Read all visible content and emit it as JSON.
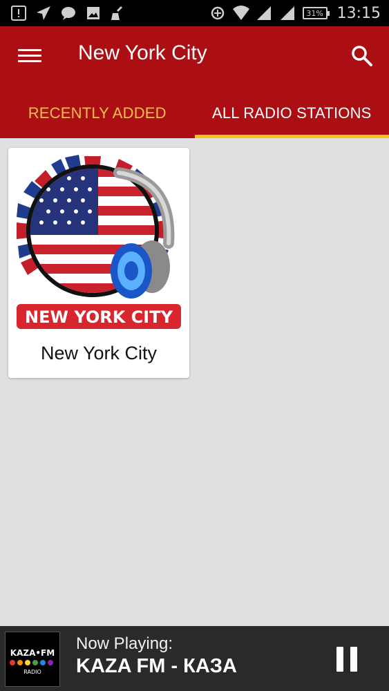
{
  "status_bar": {
    "time": "13:15",
    "battery": "31%",
    "icons": [
      "alert-icon",
      "send-icon",
      "chat-icon",
      "image-icon",
      "cleaner-icon",
      "data-saver-icon",
      "wifi-icon",
      "signal-1-icon",
      "signal-2-icon"
    ]
  },
  "app_bar": {
    "title": "New York City",
    "menu_icon": "hamburger-menu-icon",
    "search_icon": "search-icon"
  },
  "tabs": [
    {
      "label": "RECENTLY ADDED",
      "selected": false
    },
    {
      "label": "ALL RADIO STATIONS",
      "selected": true
    }
  ],
  "stations": [
    {
      "name": "New York City",
      "logo_text": "NEW YORK CITY"
    }
  ],
  "player": {
    "label": "Now Playing:",
    "station": "KAZA FM - КАЗА",
    "logo_text": "KAZA•FM",
    "logo_subtext": "RADIO",
    "control": "pause-icon"
  },
  "colors": {
    "primary": "#ab0f13",
    "tab_indicator": "#f5c21b",
    "tab_unselected_text": "#f7c04d",
    "background": "#e0e0e0",
    "player_background": "#2a2a2a"
  }
}
